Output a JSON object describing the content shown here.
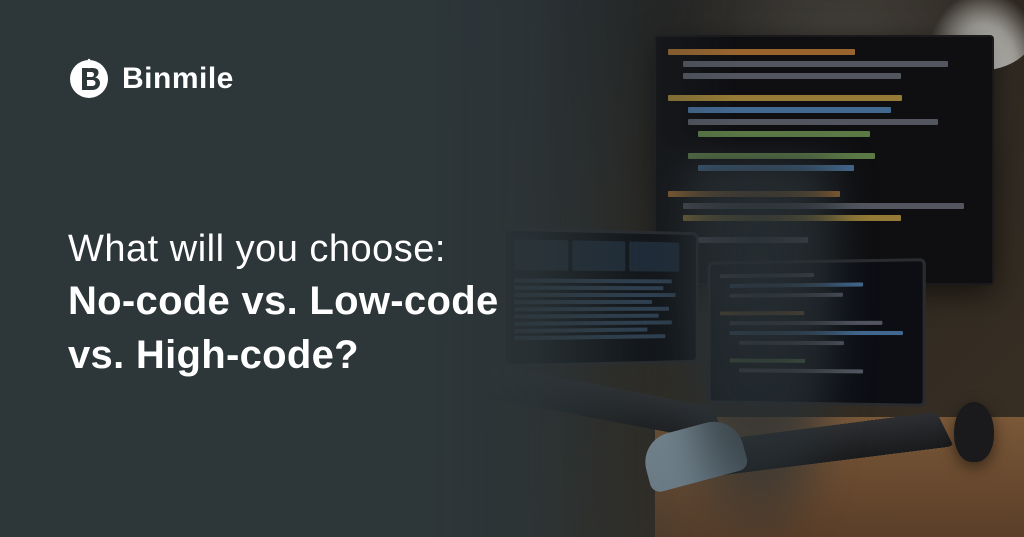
{
  "brand": {
    "name": "Binmile"
  },
  "headline": {
    "intro": "What will you choose:",
    "line1": "No-code vs. Low-code",
    "line2": "vs. High-code?"
  }
}
